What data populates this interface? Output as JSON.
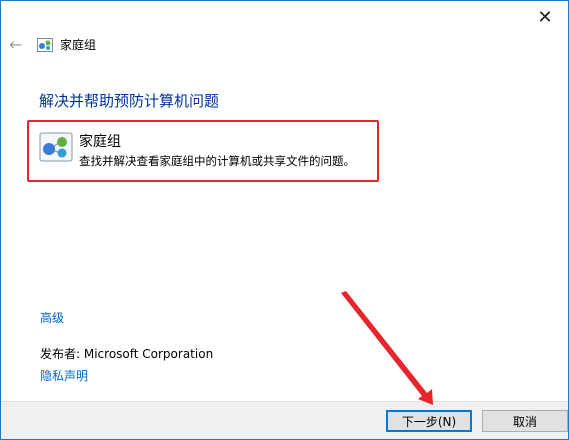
{
  "window": {
    "title": "家庭组",
    "close_glyph": "✕",
    "back_glyph": "←"
  },
  "main": {
    "heading": "解决并帮助预防计算机问题",
    "item": {
      "title": "家庭组",
      "description": "查找并解决查看家庭组中的计算机或共享文件的问题。"
    },
    "advanced_label": "高级",
    "publisher_text": "发布者:  Microsoft Corporation",
    "privacy_label": "隐私声明"
  },
  "footer": {
    "next_label": "下一步(N)",
    "cancel_label": "取消"
  },
  "colors": {
    "accent": "#0078d7",
    "highlight": "#e5262c",
    "link": "#0066cc",
    "heading": "#003399"
  }
}
